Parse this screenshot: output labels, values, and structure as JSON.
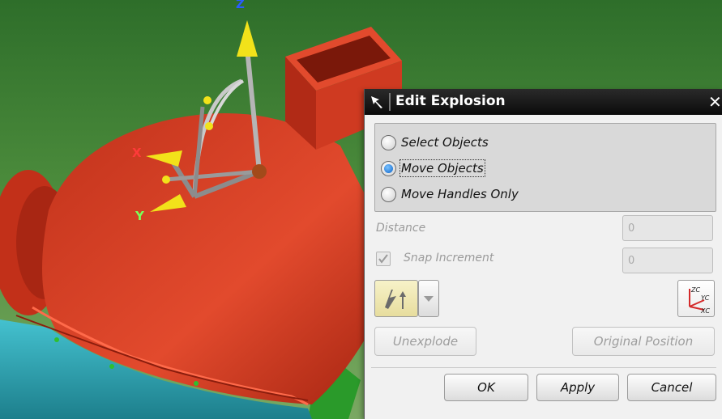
{
  "viewport": {
    "axis_labels": {
      "x": "X",
      "y": "Y",
      "z": "Z"
    }
  },
  "dialog": {
    "title": "Edit Explosion",
    "close_glyph": "✕",
    "radio_options": [
      {
        "label": "Select Objects",
        "selected": false
      },
      {
        "label": "Move Objects",
        "selected": true
      },
      {
        "label": "Move Handles Only",
        "selected": false
      }
    ],
    "distance": {
      "label": "Distance",
      "value": "0"
    },
    "snap_increment": {
      "label": "Snap Increment",
      "checked": true,
      "value": "0"
    },
    "buttons": {
      "unexplode": "Unexplode",
      "original_position": "Original Position",
      "ok": "OK",
      "apply": "Apply",
      "cancel": "Cancel"
    },
    "icons": [
      "pin-icon",
      "snap-handle-icon",
      "chevron-down-icon",
      "wcs-orient-icon"
    ]
  },
  "colors": {
    "background": "#3f7d35",
    "part_red": "#c8361f",
    "part_cyan": "#3fb6c4",
    "handle_yellow": "#f2e21a",
    "titlebar": "#111111"
  }
}
